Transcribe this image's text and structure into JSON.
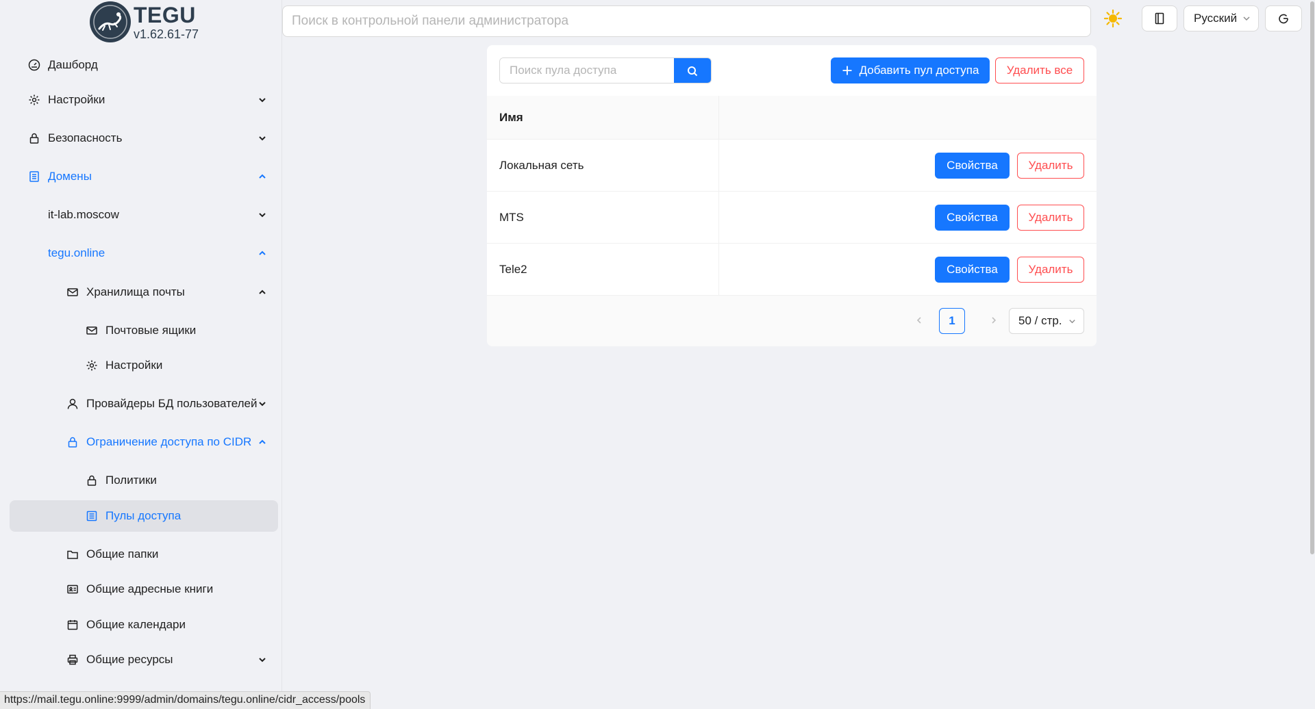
{
  "app": {
    "name": "TEGU",
    "version": "v1.62.61-77"
  },
  "search": {
    "placeholder": "Поиск в контрольной панели администратора"
  },
  "header": {
    "language": "Русский"
  },
  "sidebar": {
    "items": [
      {
        "label": "Дашборд",
        "icon": "dashboard-icon"
      },
      {
        "label": "Настройки",
        "icon": "gear-icon"
      },
      {
        "label": "Безопасность",
        "icon": "lock-icon"
      },
      {
        "label": "Домены",
        "icon": "domains-icon"
      },
      {
        "label": "it-lab.moscow"
      },
      {
        "label": "tegu.online"
      },
      {
        "label": "Хранилища почты",
        "icon": "mail-icon"
      },
      {
        "label": "Почтовые ящики",
        "icon": "mail-icon"
      },
      {
        "label": "Настройки",
        "icon": "gear-icon"
      },
      {
        "label": "Провайдеры БД пользователей",
        "icon": "user-icon"
      },
      {
        "label": "Ограничение доступа по CIDR",
        "icon": "lock-icon"
      },
      {
        "label": "Политики",
        "icon": "lock-icon"
      },
      {
        "label": "Пулы доступа",
        "icon": "pool-icon"
      },
      {
        "label": "Общие папки",
        "icon": "folder-icon"
      },
      {
        "label": "Общие адресные книги",
        "icon": "addressbook-icon"
      },
      {
        "label": "Общие календари",
        "icon": "calendar-icon"
      },
      {
        "label": "Общие ресурсы",
        "icon": "printer-icon"
      }
    ]
  },
  "pools": {
    "search_placeholder": "Поиск пула доступа",
    "add_label": "Добавить пул доступа",
    "delete_all_label": "Удалить все",
    "column_name": "Имя",
    "properties_label": "Свойства",
    "delete_label": "Удалить",
    "rows": [
      {
        "name": "Локальная сеть"
      },
      {
        "name": "MTS"
      },
      {
        "name": "Tele2"
      }
    ],
    "pagination": {
      "current_page": "1",
      "page_size": "50 / стр."
    }
  },
  "status_bar": {
    "url": "https://mail.tegu.online:9999/admin/domains/tegu.online/cidr_access/pools"
  },
  "colors": {
    "accent": "#1677ff",
    "danger": "#ff4d4f",
    "logo": "#2e3e4e",
    "background": "#f0f1f5"
  }
}
